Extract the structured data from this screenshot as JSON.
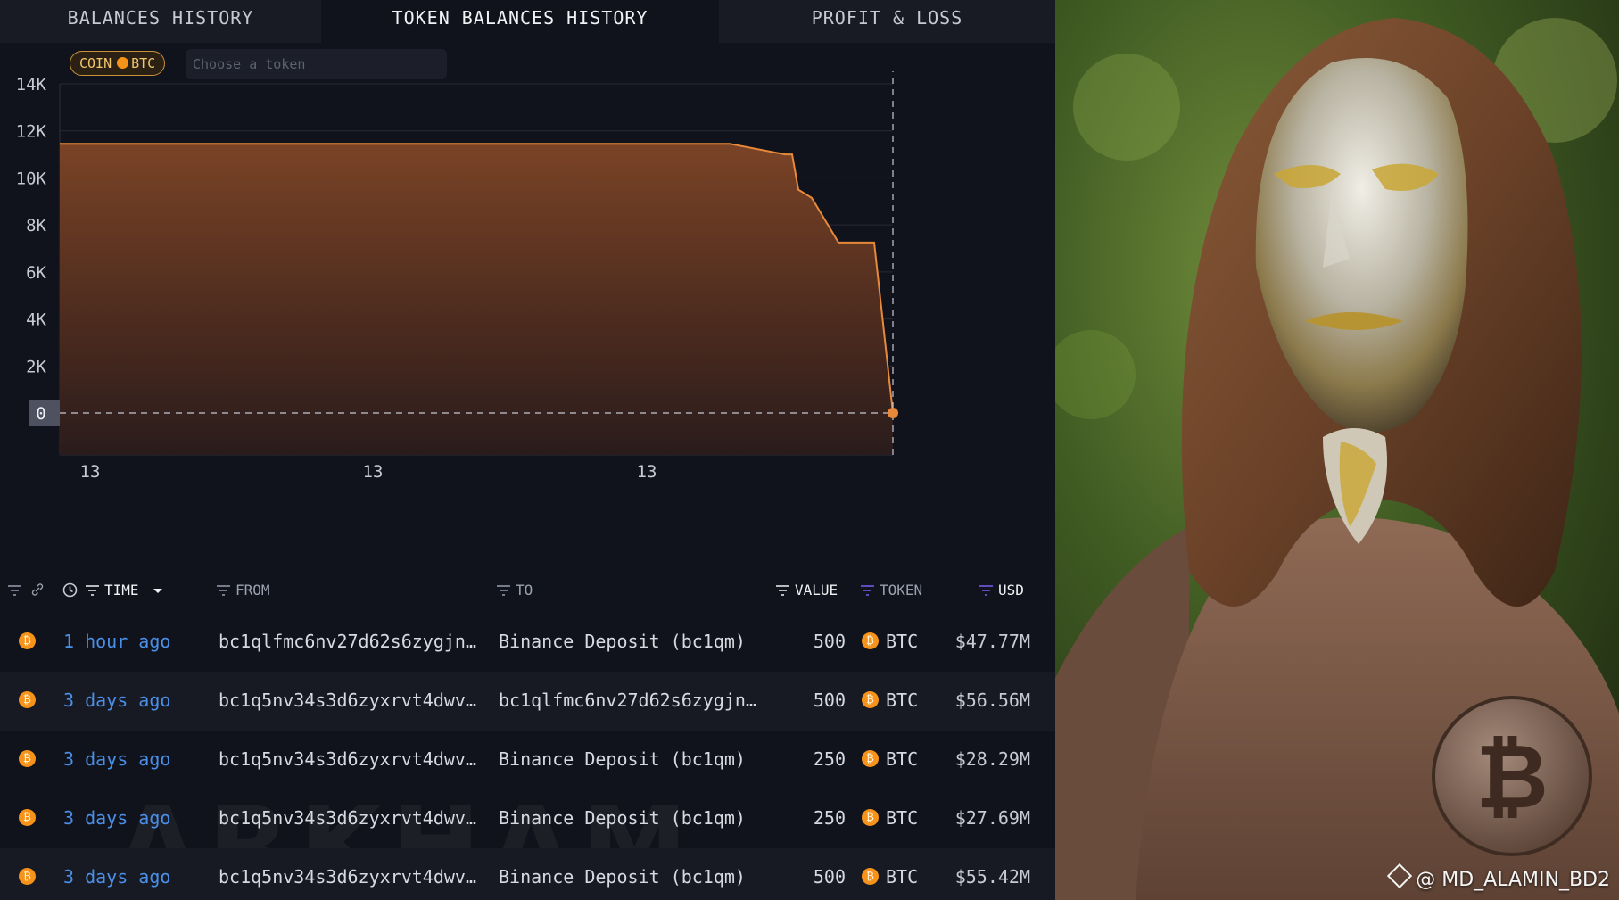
{
  "tabs": [
    {
      "label": "BALANCES HISTORY",
      "active": false
    },
    {
      "label": "TOKEN BALANCES HISTORY",
      "active": true
    },
    {
      "label": "PROFIT & LOSS",
      "active": false
    }
  ],
  "filters": {
    "coin_chip": {
      "kind": "COIN",
      "symbol": "BTC"
    },
    "token_placeholder": "Choose a token"
  },
  "chart_data": {
    "type": "area",
    "y_ticks": [
      "14K",
      "12K",
      "10K",
      "8K",
      "6K",
      "4K",
      "2K",
      "0"
    ],
    "ylim": [
      0,
      14000
    ],
    "current_value_label": "0",
    "x_tick_labels": [
      "13",
      "13",
      "13"
    ],
    "series": [
      {
        "values": [
          11450,
          11450,
          11450,
          11000,
          11000,
          9500,
          9150,
          7250,
          7250,
          0
        ],
        "color": "#e8893a"
      }
    ],
    "grid": true,
    "legend": "none"
  },
  "table": {
    "columns": {
      "time": "TIME",
      "from": "FROM",
      "to": "TO",
      "value": "VALUE",
      "token": "TOKEN",
      "usd": "USD"
    },
    "rows": [
      {
        "time": "1 hour ago",
        "from": "bc1qlfmc6nv27d62s6zygjn…",
        "to": "Binance Deposit (bc1qm)",
        "value": "500",
        "token": "BTC",
        "usd": "$47.77M"
      },
      {
        "time": "3 days ago",
        "from": "bc1q5nv34s3d6zyxrvt4dwv…",
        "to": "bc1qlfmc6nv27d62s6zygjn…",
        "value": "500",
        "token": "BTC",
        "usd": "$56.56M"
      },
      {
        "time": "3 days ago",
        "from": "bc1q5nv34s3d6zyxrvt4dwv…",
        "to": "Binance Deposit (bc1qm)",
        "value": "250",
        "token": "BTC",
        "usd": "$28.29M"
      },
      {
        "time": "3 days ago",
        "from": "bc1q5nv34s3d6zyxrvt4dwv…",
        "to": "Binance Deposit (bc1qm)",
        "value": "250",
        "token": "BTC",
        "usd": "$27.69M"
      },
      {
        "time": "3 days ago",
        "from": "bc1q5nv34s3d6zyxrvt4dwv…",
        "to": "Binance Deposit (bc1qm)",
        "value": "500",
        "token": "BTC",
        "usd": "$55.42M"
      }
    ]
  },
  "watermark": "ARKHAM",
  "photo": {
    "credit": "@ MD_ALAMIN_BD2",
    "bitcoin_symbol": "₿"
  },
  "colors": {
    "accent_orange": "#e8893a",
    "link_blue": "#4a8fe8",
    "btc": "#f7931a"
  }
}
